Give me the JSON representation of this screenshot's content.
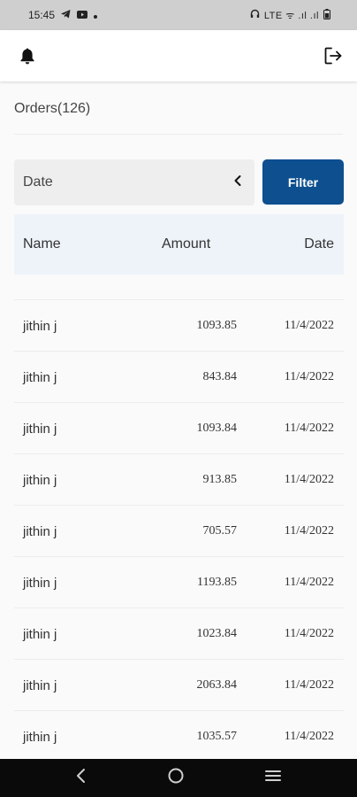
{
  "status_bar": {
    "time": "15:45",
    "right_text": "LTE ᯤ .ıl .ıl"
  },
  "app_bar": {
    "notifications_icon": "bell-icon",
    "logout_icon": "logout-icon"
  },
  "page": {
    "title": "Orders(126)"
  },
  "filter": {
    "date_select_label": "Date",
    "filter_button_label": "Filter"
  },
  "table": {
    "columns": [
      "Name",
      "Amount",
      "Date"
    ],
    "rows": [
      {
        "name": "jithin j",
        "amount": "1093.85",
        "date": "11/4/2022"
      },
      {
        "name": "jithin j",
        "amount": "843.84",
        "date": "11/4/2022"
      },
      {
        "name": "jithin j",
        "amount": "1093.84",
        "date": "11/4/2022"
      },
      {
        "name": "jithin j",
        "amount": "913.85",
        "date": "11/4/2022"
      },
      {
        "name": "jithin j",
        "amount": "705.57",
        "date": "11/4/2022"
      },
      {
        "name": "jithin j",
        "amount": "1193.85",
        "date": "11/4/2022"
      },
      {
        "name": "jithin j",
        "amount": "1023.84",
        "date": "11/4/2022"
      },
      {
        "name": "jithin j",
        "amount": "2063.84",
        "date": "11/4/2022"
      },
      {
        "name": "jithin j",
        "amount": "1035.57",
        "date": "11/4/2022"
      }
    ]
  },
  "colors": {
    "accent": "#0d4f8f",
    "table_header_bg": "#eef3fa"
  }
}
